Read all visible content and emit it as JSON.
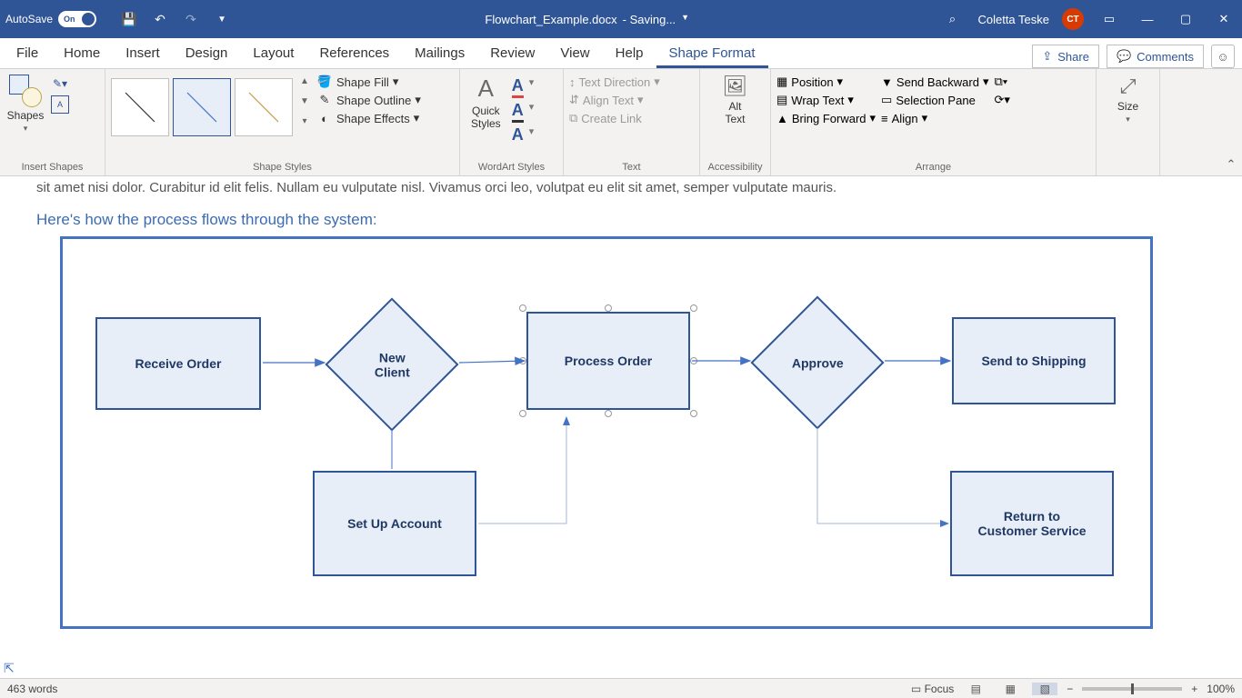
{
  "titlebar": {
    "autosave_label": "AutoSave",
    "autosave_state": "On",
    "filename": "Flowchart_Example.docx",
    "saving": "- Saving...",
    "user_name": "Coletta Teske",
    "user_initials": "CT"
  },
  "tabs": {
    "items": [
      "File",
      "Home",
      "Insert",
      "Design",
      "Layout",
      "References",
      "Mailings",
      "Review",
      "View",
      "Help",
      "Shape Format"
    ],
    "active": "Shape Format",
    "share": "Share",
    "comments": "Comments"
  },
  "ribbon": {
    "insert_shapes": {
      "shapes": "Shapes",
      "group": "Insert Shapes"
    },
    "shape_styles": {
      "fill": "Shape Fill",
      "outline": "Shape Outline",
      "effects": "Shape Effects",
      "group": "Shape Styles"
    },
    "wordart": {
      "quick": "Quick\nStyles",
      "group": "WordArt Styles"
    },
    "text": {
      "direction": "Text Direction",
      "align": "Align Text",
      "link": "Create Link",
      "group": "Text"
    },
    "accessibility": {
      "alt": "Alt\nText",
      "group": "Accessibility"
    },
    "arrange": {
      "position": "Position",
      "wrap": "Wrap Text",
      "forward": "Bring Forward",
      "backward": "Send Backward",
      "selection": "Selection Pane",
      "align": "Align",
      "group": "Arrange"
    },
    "size": {
      "label": "Size"
    }
  },
  "document": {
    "partial_line": "sit amet nisi dolor. Curabitur id elit felis. Nullam eu vulputate nisl. Vivamus orci leo, volutpat eu elit sit amet, semper vulputate mauris.",
    "intro": "Here's how the process flows through the system:",
    "shapes": {
      "receive": "Receive Order",
      "new_client": "New\nClient",
      "process": "Process Order",
      "approve": "Approve",
      "shipping": "Send to Shipping",
      "setup": "Set Up Account",
      "return": "Return to\nCustomer Service"
    }
  },
  "status": {
    "words": "463 words",
    "focus": "Focus",
    "zoom": "100%"
  }
}
